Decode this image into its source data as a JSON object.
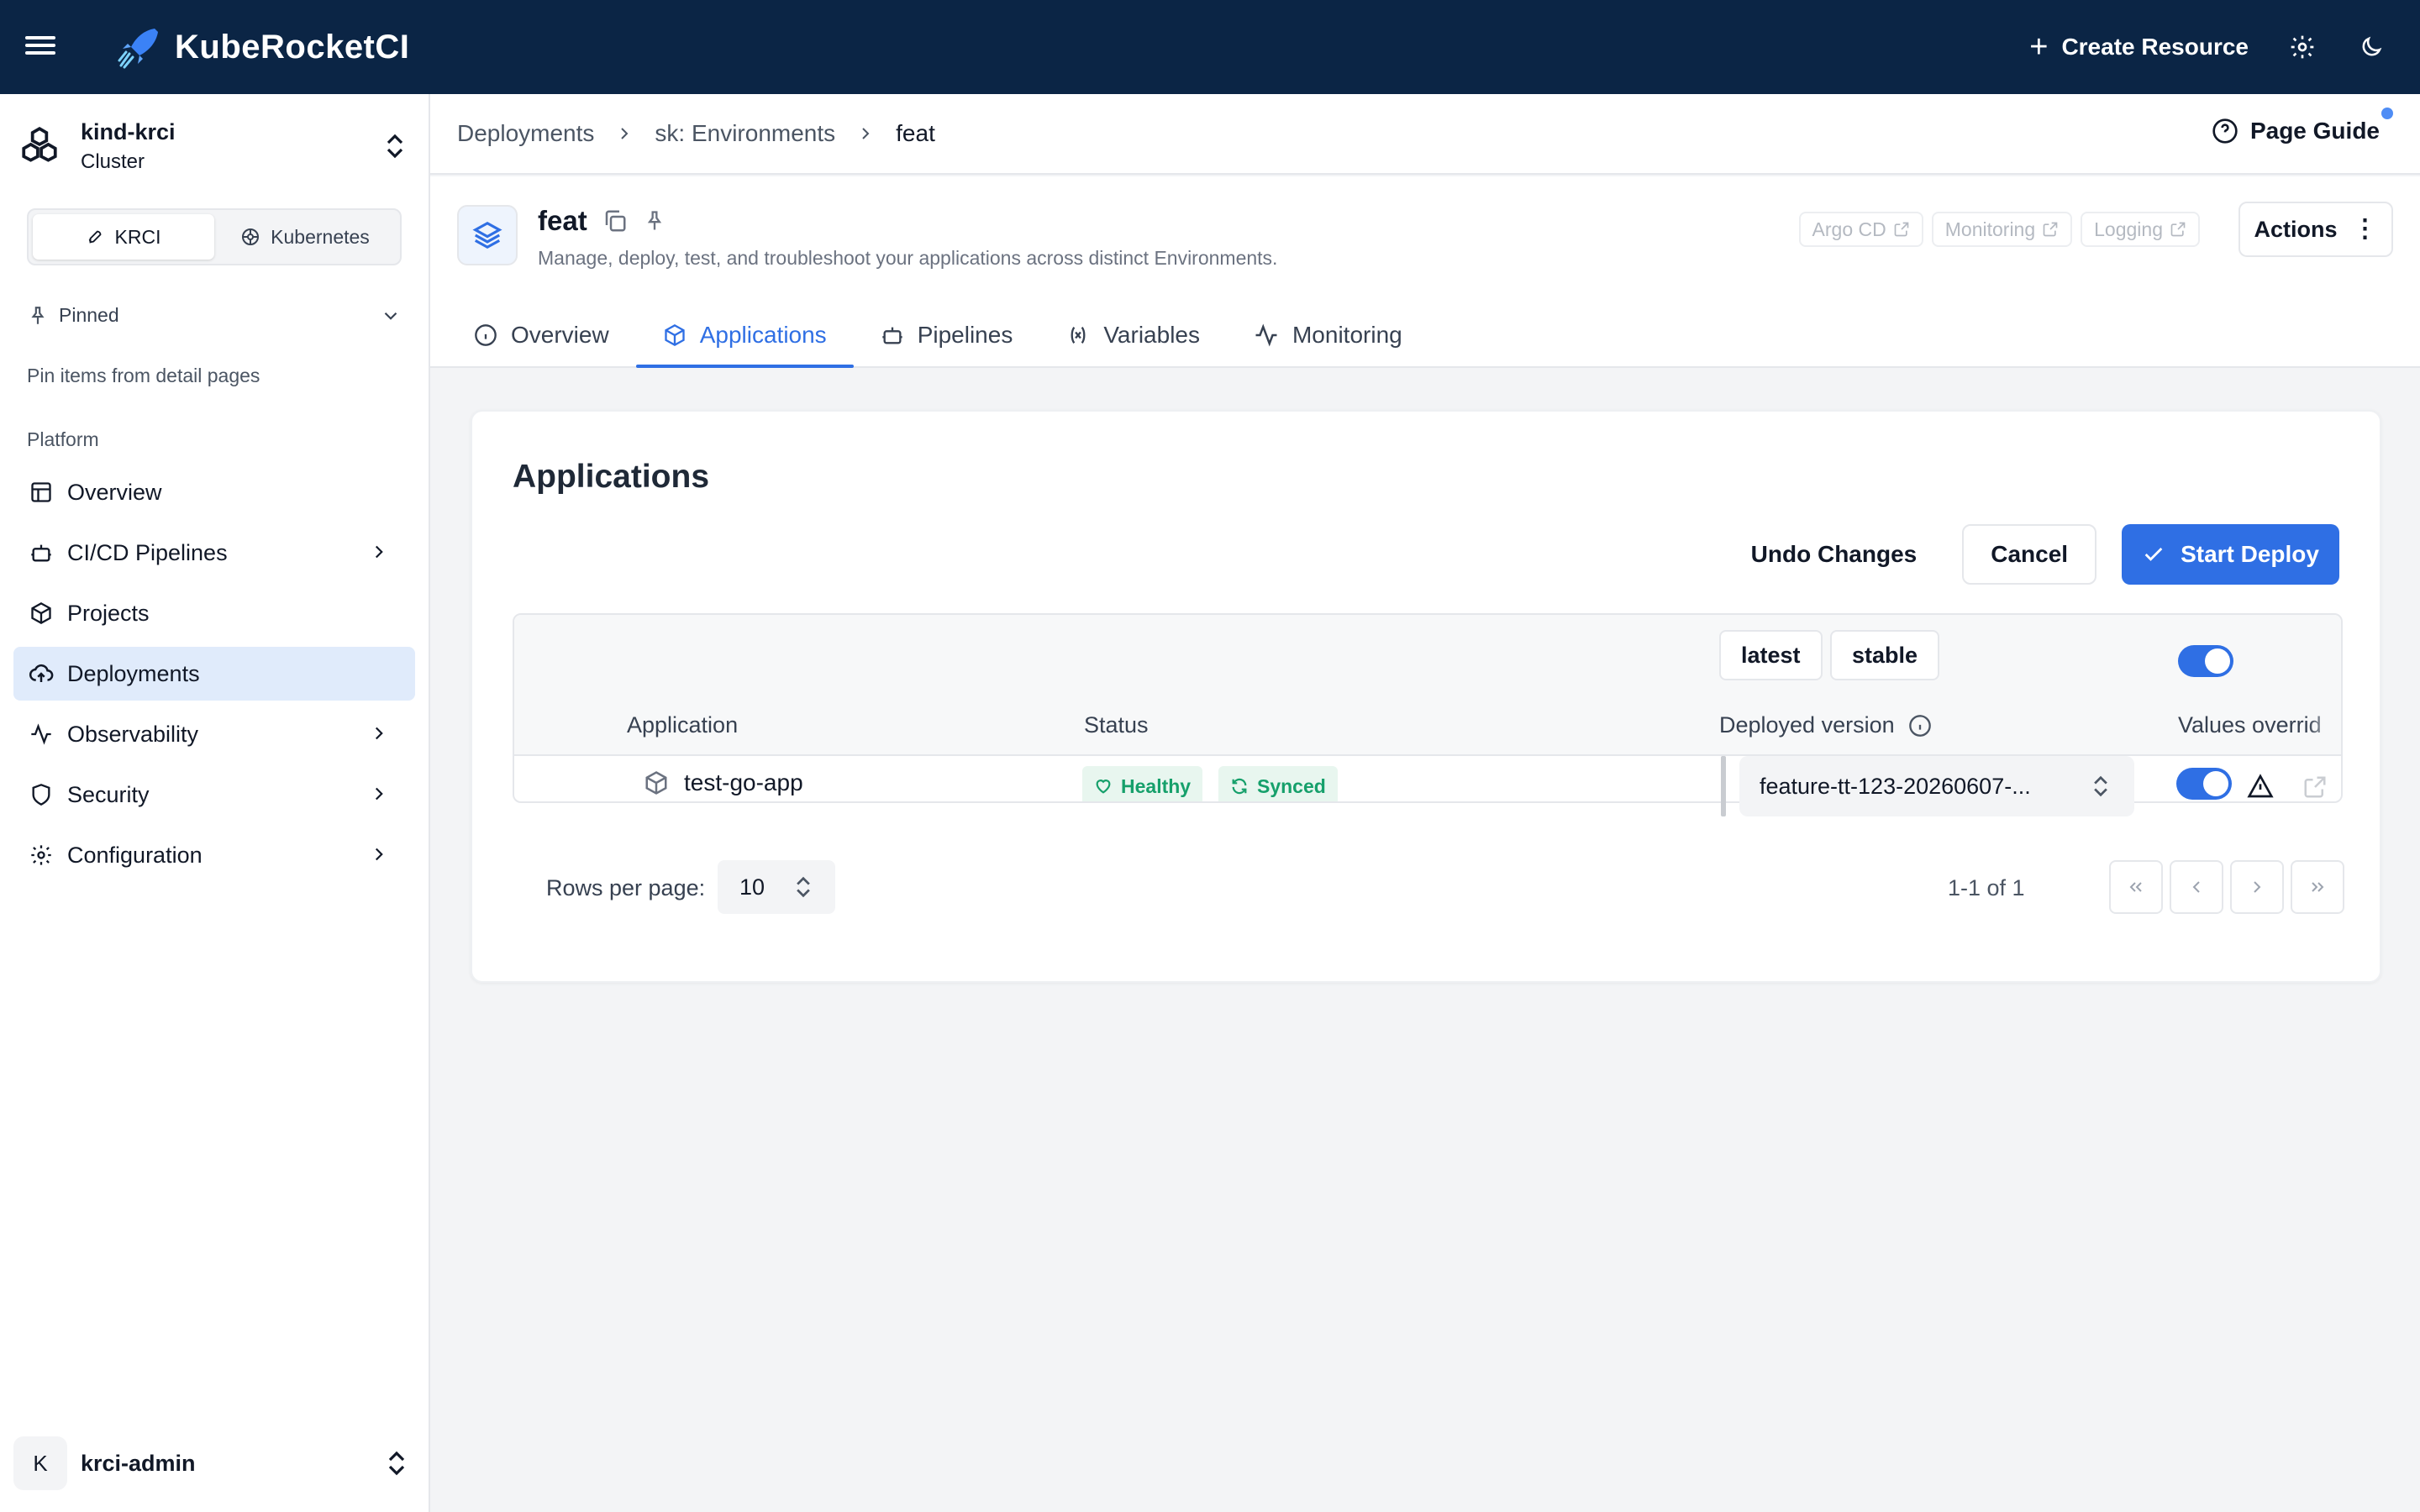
{
  "topbar": {
    "brand": "KubeRocketCI",
    "create_label": "Create Resource",
    "icons": [
      "menu-icon",
      "rocket-logo-icon",
      "plus-icon",
      "gear-icon",
      "moon-icon"
    ]
  },
  "sidebar": {
    "cluster_name": "kind-krci",
    "cluster_type": "Cluster",
    "switch": {
      "krci": "KRCI",
      "kubernetes": "Kubernetes",
      "active": "KRCI"
    },
    "pinned_label": "Pinned",
    "pinned_hint": "Pin items from detail pages",
    "section_label": "Platform",
    "items": [
      {
        "label": "Overview",
        "icon": "layout-icon",
        "has_children": false
      },
      {
        "label": "CI/CD Pipelines",
        "icon": "bot-icon",
        "has_children": true
      },
      {
        "label": "Projects",
        "icon": "box-icon",
        "has_children": false
      },
      {
        "label": "Deployments",
        "icon": "cloud-upload-icon",
        "has_children": false,
        "active": true
      },
      {
        "label": "Observability",
        "icon": "activity-icon",
        "has_children": true
      },
      {
        "label": "Security",
        "icon": "shield-icon",
        "has_children": true
      },
      {
        "label": "Configuration",
        "icon": "gear-icon",
        "has_children": true
      }
    ],
    "user": {
      "initial": "K",
      "name": "krci-admin"
    }
  },
  "breadcrumb": {
    "items": [
      "Deployments",
      "sk: Environments",
      "feat"
    ],
    "page_guide": "Page Guide"
  },
  "header": {
    "title": "feat",
    "description": "Manage, deploy, test, and troubleshoot your applications across distinct Environments.",
    "links": [
      "Argo CD",
      "Monitoring",
      "Logging"
    ],
    "actions_label": "Actions"
  },
  "tabs": [
    {
      "label": "Overview",
      "icon": "info-icon"
    },
    {
      "label": "Applications",
      "icon": "box-icon",
      "active": true
    },
    {
      "label": "Pipelines",
      "icon": "bot-icon"
    },
    {
      "label": "Variables",
      "icon": "variable-icon"
    },
    {
      "label": "Monitoring",
      "icon": "activity-icon"
    }
  ],
  "applications": {
    "title": "Applications",
    "undo_label": "Undo Changes",
    "cancel_label": "Cancel",
    "deploy_label": "Start Deploy",
    "bulk_version_buttons": [
      "latest",
      "stable"
    ],
    "columns": [
      "Application",
      "Status",
      "Deployed version",
      "Values overrid"
    ],
    "values_override_all": true,
    "rows": [
      {
        "application": "test-go-app",
        "health": "Healthy",
        "sync": "Synced",
        "version": "feature-tt-123-20260607-...",
        "values_override": true
      }
    ],
    "pagination": {
      "rows_label": "Rows per page:",
      "rows_value": "10",
      "range": "1-1 of 1"
    }
  },
  "colors": {
    "topbar_bg": "#0b2545",
    "accent": "#2f6fe4",
    "healthy": "#16a06b",
    "active_nav_bg": "#e0ebfb"
  }
}
